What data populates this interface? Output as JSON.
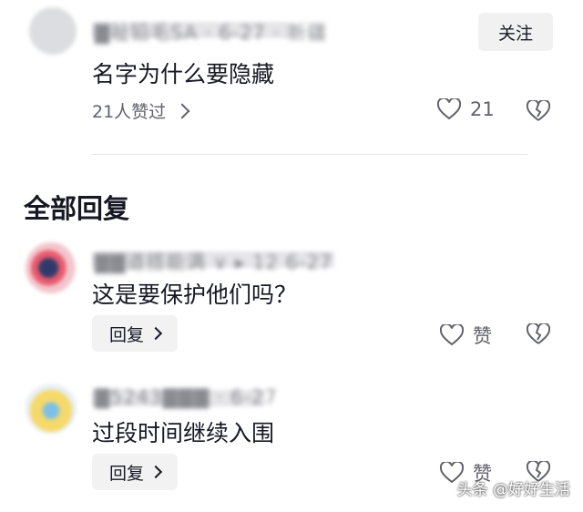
{
  "comment": {
    "username": "▇祉铅毛SA · 6-27 · 新疆",
    "text": "名字为什么要隐藏",
    "follow_label": "关注",
    "liked_by": "21人赞过",
    "like_count": "21"
  },
  "section_title": "全部回复",
  "replies": [
    {
      "username": "▇▇道搭能满 ∨ ▸ 12 6-27",
      "text": "这是要保护他们吗？",
      "reply_label": "回复",
      "like_label": "赞"
    },
    {
      "username": "▇5243▇▇▇ · 6-27",
      "text": "过段时间继续入围",
      "reply_label": "回复",
      "like_label": "赞"
    }
  ],
  "watermark": "头条 @好好生活",
  "icons": {
    "like": "heart-outline-icon",
    "dislike": "broken-heart-icon",
    "chevron": "chevron-right-icon"
  },
  "colors": {
    "text": "#161823",
    "secondary": "#61626b",
    "button_bg": "#f2f2f3"
  }
}
